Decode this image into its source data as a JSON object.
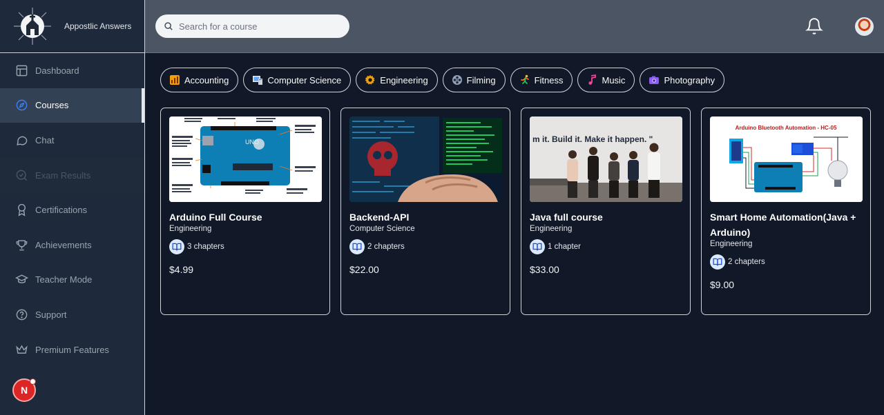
{
  "sidebar": {
    "brand": "Appostlic Answers",
    "items": [
      {
        "label": "Dashboard",
        "icon": "layout-icon",
        "state": "normal"
      },
      {
        "label": "Courses",
        "icon": "compass-icon",
        "state": "active"
      },
      {
        "label": "Chat",
        "icon": "chat-icon",
        "state": "normal"
      },
      {
        "label": "Exam Results",
        "icon": "search-check-icon",
        "state": "disabled"
      },
      {
        "label": "Certifications",
        "icon": "award-icon",
        "state": "normal"
      },
      {
        "label": "Achievements",
        "icon": "trophy-icon",
        "state": "normal"
      },
      {
        "label": "Teacher Mode",
        "icon": "graduation-cap-icon",
        "state": "normal"
      },
      {
        "label": "Support",
        "icon": "help-circle-icon",
        "state": "normal"
      },
      {
        "label": "Premium Features",
        "icon": "crown-icon",
        "state": "normal"
      }
    ],
    "user_initial": "N"
  },
  "topbar": {
    "search_placeholder": "Search for a course"
  },
  "categories": [
    {
      "label": "Accounting",
      "icon": "bar-chart-emoji"
    },
    {
      "label": "Computer Science",
      "icon": "computer-emoji"
    },
    {
      "label": "Engineering",
      "icon": "gear-emoji"
    },
    {
      "label": "Filming",
      "icon": "film-reel-emoji"
    },
    {
      "label": "Fitness",
      "icon": "runner-emoji"
    },
    {
      "label": "Music",
      "icon": "music-note-emoji"
    },
    {
      "label": "Photography",
      "icon": "camera-emoji"
    }
  ],
  "courses": [
    {
      "title": "Arduino Full Course",
      "category": "Engineering",
      "chapters": "3 chapters",
      "price": "$4.99"
    },
    {
      "title": "Backend-API",
      "category": "Computer Science",
      "chapters": "2 chapters",
      "price": "$22.00"
    },
    {
      "title": "Java full course",
      "category": "Engineering",
      "chapters": "1 chapter",
      "price": "$33.00"
    },
    {
      "title": "Smart Home Automation(Java + Arduino)",
      "category": "Engineering",
      "chapters": "2 chapters",
      "price": "$9.00"
    }
  ],
  "images": {
    "team_banner": "m it. Build it. Make it happen. \"",
    "arduino_bt_title": "Arduino Bluetooth Automation - HC-05"
  },
  "colors": {
    "sidebar_bg": "#1e293b",
    "topbar_bg": "#4b5563",
    "main_bg": "#111827",
    "active_item_bg": "#334155"
  }
}
